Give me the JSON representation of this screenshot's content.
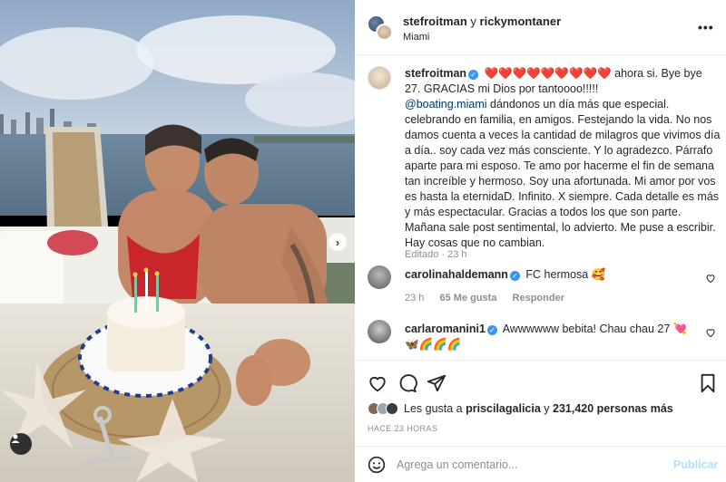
{
  "header": {
    "user1": "stefroitman",
    "joiner": " y ",
    "user2": "rickymontaner",
    "location": "Miami",
    "more_label": "•••"
  },
  "caption": {
    "username": "stefroitman",
    "hearts": "❤️❤️❤️❤️❤️❤️❤️❤️❤️",
    "line1": " ahora si. Bye bye 27. GRACIAS mi Dios por tantoooo!!!!!",
    "mention": "@boating.miami",
    "body": " dándonos un día más que especial. celebrando en familia, en amigos. Festejando la vida. No nos damos cuenta a veces la cantidad de milagros que vivimos día a día.. soy cada vez más consciente. Y lo agradezco. Párrafo aparte para mi esposo. Te amo por hacerme el fin de semana tan increíble y hermoso. Soy una afortunada. Mi amor por vos es hasta la eternidaD. Infinito. X siempre. Cada detalle es más y más espectacular. Gracias a todos los que son parte. Mañana sale post sentimental, lo advierto. Me puse a escribir. Hay cosas que no cambian.",
    "meta": "Editado · 23 h"
  },
  "comments": [
    {
      "username": "carolinahaldemann",
      "text": " FC hermosa 🥰",
      "time": "23 h",
      "likes": "65 Me gusta",
      "reply": "Responder"
    },
    {
      "username": "carlaromanini1",
      "text": " Awwwwww bebita! Chau chau 27 💘🦋🌈🌈🌈"
    }
  ],
  "likes": {
    "prefix": "Les gusta a ",
    "user": "priscilagalicia",
    "middle": " y ",
    "count": "231,420 personas más"
  },
  "timeago": "HACE 23 HORAS",
  "comment_box": {
    "placeholder": "Agrega un comentario...",
    "publish_label": "Publicar"
  },
  "colors": {
    "verified": "#3897f0",
    "mention": "#00376b",
    "publish_disabled": "#b2dffc",
    "muted": "#8e8e8e"
  },
  "icons": {
    "caption_heart_row": "heart-emoji",
    "actions": [
      "heart-icon",
      "comment-icon",
      "share-icon",
      "bookmark-icon"
    ],
    "comment_emoji": "emoji-icon"
  }
}
